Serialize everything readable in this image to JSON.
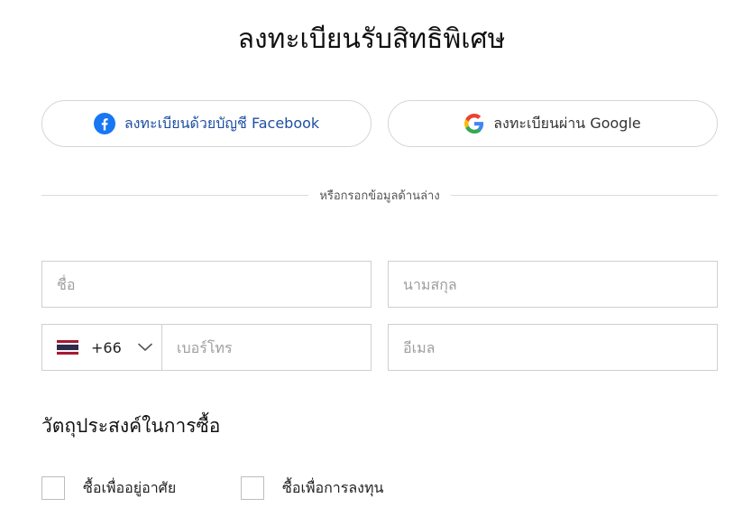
{
  "title": "ลงทะเบียนรับสิทธิพิเศษ",
  "social": {
    "facebook_label": "ลงทะเบียนด้วยบัญชี Facebook",
    "google_label": "ลงทะเบียนผ่าน Google"
  },
  "divider_text": "หรือกรอกข้อมูลด้านล่าง",
  "form": {
    "first_name_placeholder": "ชื่อ",
    "last_name_placeholder": "นามสกุล",
    "country_code": "+66",
    "phone_placeholder": "เบอร์โทร",
    "email_placeholder": "อีเมล"
  },
  "purpose": {
    "title": "วัตถุประสงค์ในการซื้อ",
    "options": [
      {
        "label": "ซื้อเพื่ออยู่อาศัย",
        "checked": false
      },
      {
        "label": "ซื้อเพื่อการลงทุน",
        "checked": false
      }
    ]
  },
  "colors": {
    "facebook_blue": "#1877F2",
    "facebook_text": "#1f4fa3",
    "border": "#cfcfcf"
  },
  "icons": {
    "facebook": "facebook-icon",
    "google": "google-icon",
    "flag": "thailand-flag-icon",
    "chevron": "chevron-down-icon"
  }
}
